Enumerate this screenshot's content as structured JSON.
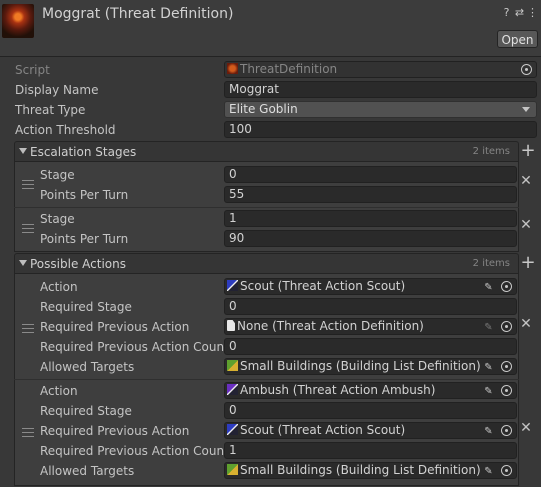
{
  "header": {
    "title": "Moggrat (Threat Definition)",
    "open_label": "Open",
    "icons": [
      "help-icon",
      "preset-icon",
      "more-menu-icon"
    ]
  },
  "fields": {
    "script_label": "Script",
    "script_value": "ThreatDefinition",
    "display_name_label": "Display Name",
    "display_name_value": "Moggrat",
    "threat_type_label": "Threat Type",
    "threat_type_value": "Elite Goblin",
    "action_threshold_label": "Action Threshold",
    "action_threshold_value": "100"
  },
  "escalation": {
    "title": "Escalation Stages",
    "count": "2 items",
    "items": [
      {
        "stage_label": "Stage",
        "stage_value": "0",
        "ppt_label": "Points Per Turn",
        "ppt_value": "55"
      },
      {
        "stage_label": "Stage",
        "stage_value": "1",
        "ppt_label": "Points Per Turn",
        "ppt_value": "90"
      }
    ]
  },
  "actions": {
    "title": "Possible Actions",
    "count": "2 items",
    "items": [
      {
        "action_label": "Action",
        "action_value": "Scout (Threat Action Scout)",
        "req_stage_label": "Required Stage",
        "req_stage_value": "0",
        "req_prev_label": "Required Previous Action",
        "req_prev_value": "None (Threat Action Definition)",
        "req_prev_count_label": "Required Previous Action Count",
        "req_prev_count_value": "0",
        "allowed_label": "Allowed Targets",
        "allowed_value": "Small Buildings (Building List Definition)"
      },
      {
        "action_label": "Action",
        "action_value": "Ambush (Threat Action Ambush)",
        "req_stage_label": "Required Stage",
        "req_stage_value": "0",
        "req_prev_label": "Required Previous Action",
        "req_prev_value": "Scout (Threat Action Scout)",
        "req_prev_count_label": "Required Previous Action Count",
        "req_prev_count_value": "1",
        "allowed_label": "Allowed Targets",
        "allowed_value": "Small Buildings (Building List Definition)"
      }
    ]
  }
}
